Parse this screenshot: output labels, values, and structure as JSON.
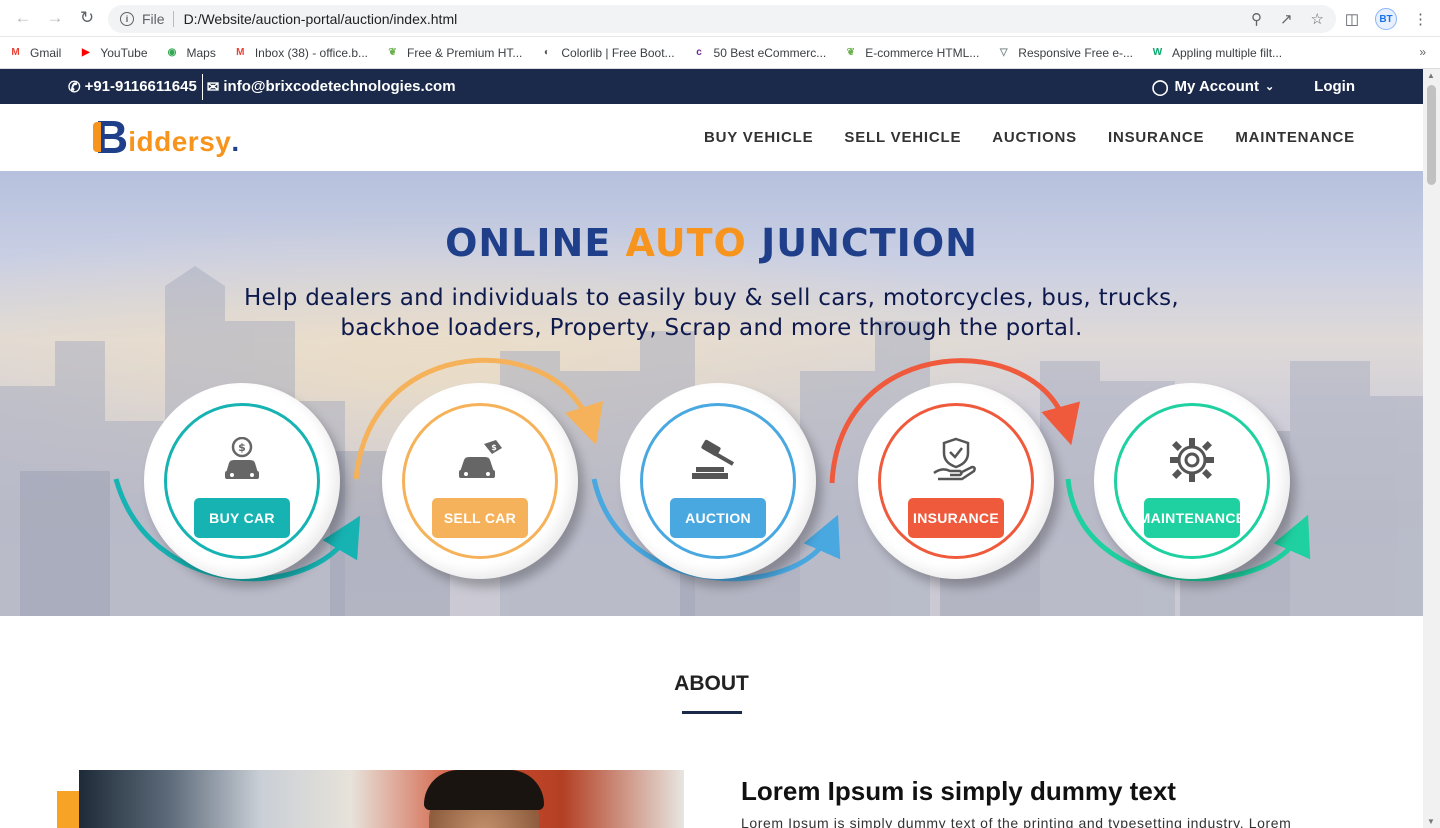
{
  "browser": {
    "url_scheme": "File",
    "url": "D:/Website/auction-portal/auction/index.html",
    "profile_initials": "BT",
    "bookmarks": [
      {
        "label": "Gmail",
        "icon": "gmail-icon",
        "color": "#ea4335"
      },
      {
        "label": "YouTube",
        "icon": "youtube-icon",
        "color": "#ff0000"
      },
      {
        "label": "Maps",
        "icon": "maps-icon",
        "color": "#34a853"
      },
      {
        "label": "Inbox (38) - office.b...",
        "icon": "gmail-icon",
        "color": "#ea4335"
      },
      {
        "label": "Free & Premium HT...",
        "icon": "leaf-icon",
        "color": "#6ab04c"
      },
      {
        "label": "Colorlib | Free Boot...",
        "icon": "colorlib-icon",
        "color": "#555555"
      },
      {
        "label": "50 Best eCommerc...",
        "icon": "colorlib-square-icon",
        "color": "#6c2a8e"
      },
      {
        "label": "E-commerce HTML...",
        "icon": "leaf-icon",
        "color": "#6ab04c"
      },
      {
        "label": "Responsive Free e-...",
        "icon": "triangle-icon",
        "color": "#7f8c8d"
      },
      {
        "label": "Appling multiple filt...",
        "icon": "w3schools-icon",
        "color": "#04aa6d"
      }
    ]
  },
  "topbar": {
    "phone": "+91-9116611645",
    "email": "info@brixcodetechnologies.com",
    "account": "My Account",
    "login": "Login"
  },
  "logo": {
    "letter": "B",
    "rest": "iddersy",
    "dot": "."
  },
  "menu": [
    "BUY VEHICLE",
    "SELL VEHICLE",
    "AUCTIONS",
    "INSURANCE",
    "MAINTENANCE"
  ],
  "hero": {
    "title_part1": "ONLINE ",
    "title_part2": "AUTO",
    "title_part3": " JUNCTION",
    "subtitle_line1": "Help dealers and individuals to easily buy & sell cars, motorcycles, bus, trucks,",
    "subtitle_line2": "backhoe loaders, Property, Scrap and more through the portal.",
    "steps": [
      {
        "label": "BUY CAR",
        "color": "#17b3b3",
        "icon": "buy-car-icon"
      },
      {
        "label": "SELL CAR",
        "color": "#f5b25a",
        "icon": "sell-car-icon"
      },
      {
        "label": "AUCTION",
        "color": "#4aa8e0",
        "icon": "gavel-icon"
      },
      {
        "label": "INSURANCE",
        "color": "#f05a3c",
        "icon": "insurance-icon"
      },
      {
        "label": "MAINTENANCE",
        "color": "#1fd1a0",
        "icon": "gear-icon"
      }
    ]
  },
  "about": {
    "title": "ABOUT",
    "heading": "Lorem Ipsum is simply dummy text",
    "paragraph": "Lorem Ipsum is simply dummy text of the printing and typesetting industry. Lorem"
  }
}
